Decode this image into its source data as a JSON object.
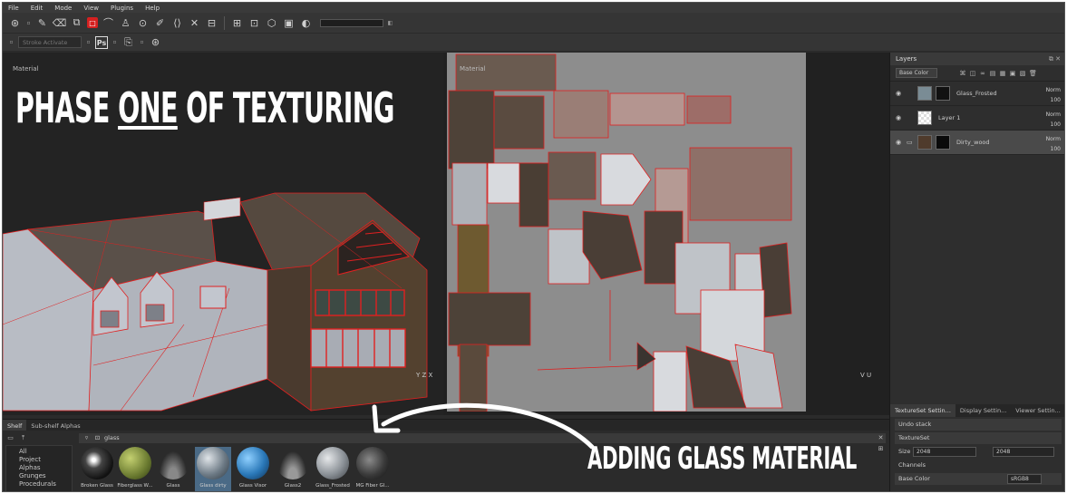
{
  "menu": [
    "File",
    "Edit",
    "Mode",
    "View",
    "Plugins",
    "Help"
  ],
  "toolbar": {
    "stroke_placeholder": "Stroke Activate",
    "ps_label": "Ps"
  },
  "viewport3d": {
    "label": "Material",
    "headline_pre": "PHASE ",
    "headline_underlined": "ONE",
    "headline_post": " OF TEXTURING",
    "gizmo": "Y Z X"
  },
  "viewportuv": {
    "label": "Material",
    "gizmo": "V U"
  },
  "layers": {
    "title": "Layers",
    "channel_select": "Base Color",
    "rows": [
      {
        "name": "Glass_Frosted",
        "blend": "Norm",
        "opacity": "100"
      },
      {
        "name": "Layer 1",
        "blend": "Norm",
        "opacity": "100"
      },
      {
        "name": "Dirty_wood",
        "blend": "Norm",
        "opacity": "100"
      }
    ]
  },
  "textureset": {
    "tabs": [
      "TextureSet Settin...",
      "Display Settin...",
      "Viewer Settin..."
    ],
    "undo_stack": "Undo stack",
    "section": "TextureSet",
    "size_label": "Size",
    "size_value": "2048",
    "size_value2": "2048",
    "channels_label": "Channels",
    "channel_name": "Base Color",
    "channel_format": "sRGB8"
  },
  "shelf": {
    "tabs": [
      "Shelf",
      "Sub-shelf Alphas"
    ],
    "search_text": "glass",
    "categories": [
      "All",
      "Project",
      "Alphas",
      "Grunges",
      "Procedurals"
    ],
    "materials": [
      "Broken Glass",
      "Fiberglass W...",
      "Glass",
      "Glass dirty",
      "Glass Visor",
      "Glass2",
      "Glass_Frosted",
      "MG Fiber Gl..."
    ]
  },
  "annotation": "ADDING GLASS MATERIAL",
  "colors": {
    "wireframe": "#e02020",
    "selection": "#4a6a86",
    "uv_background": "#8d8d8d"
  }
}
